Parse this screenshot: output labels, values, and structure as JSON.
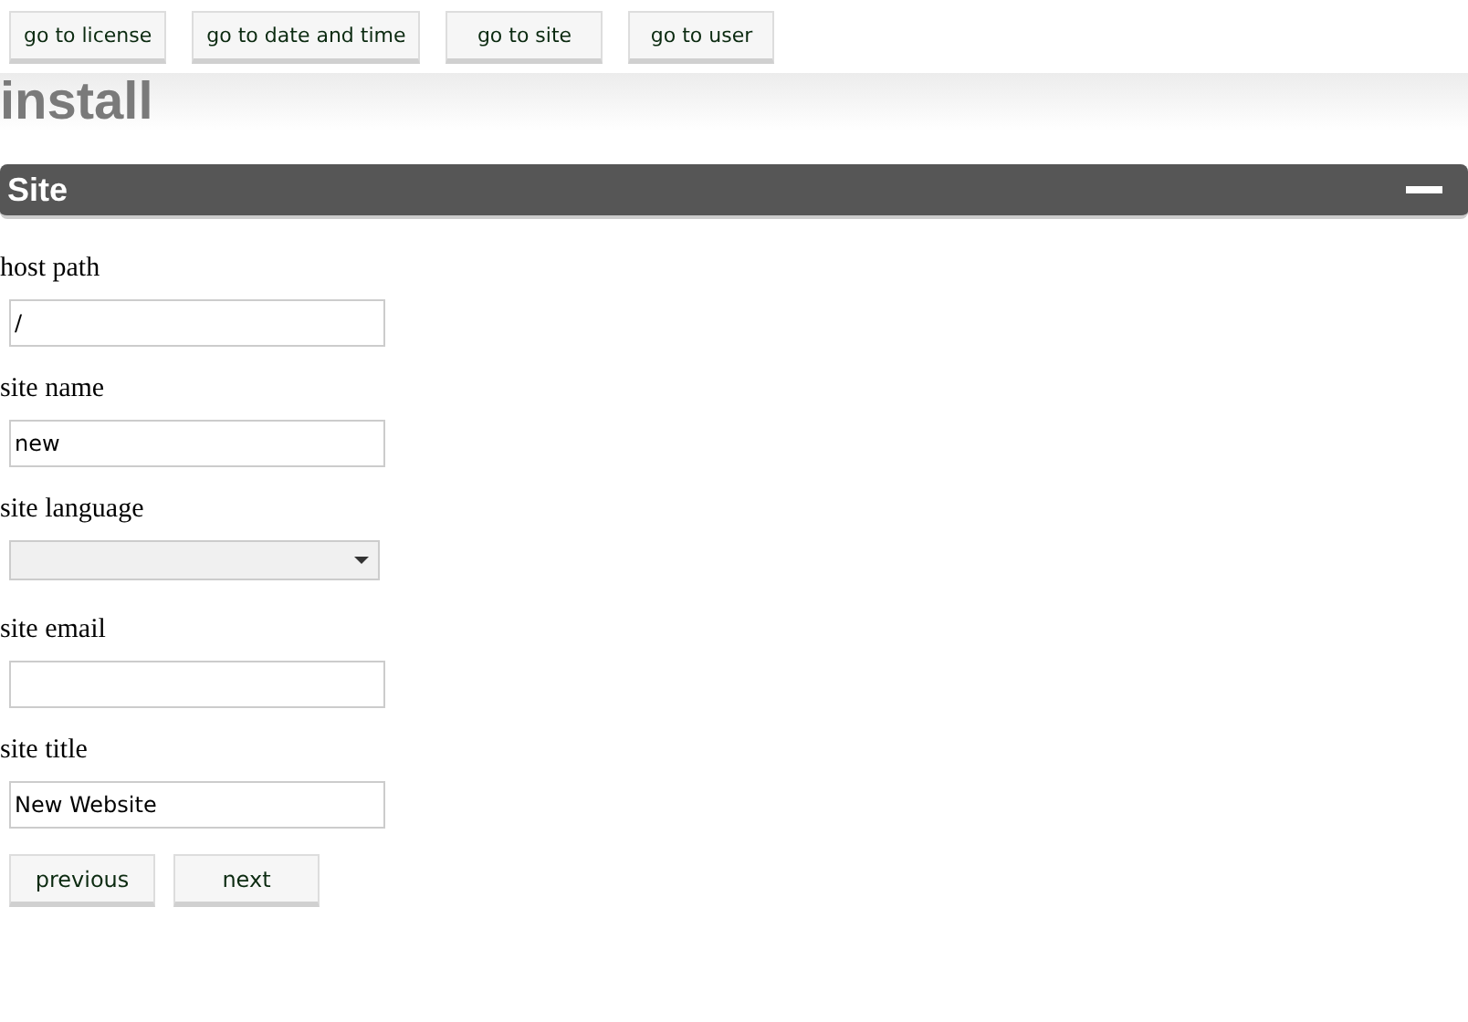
{
  "nav_buttons": [
    "go to license",
    "go to date and time",
    "go to site",
    "go to user"
  ],
  "page_title": "install",
  "section": {
    "title": "Site",
    "expanded": true
  },
  "fields": [
    {
      "label": "host path",
      "kind": "text",
      "value": "/"
    },
    {
      "label": "site name",
      "kind": "text",
      "value": "new"
    },
    {
      "label": "site language",
      "kind": "select"
    },
    {
      "label": "site email",
      "kind": "text"
    },
    {
      "label": "site title",
      "kind": "text",
      "value": "New Website"
    }
  ],
  "buttons": [
    "previous",
    "next"
  ]
}
